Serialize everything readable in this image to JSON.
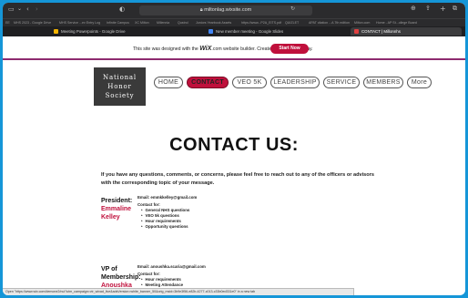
{
  "browser": {
    "url": "miltonlag.wixsite.com",
    "bookmarks": [
      "EE",
      "MHS 2023 - Google Drive",
      "MHS Service ...ev Entry Log",
      "Infinite Campus",
      "XC Milton",
      "Millennia",
      "Qustrol",
      "Juniors Yearbook Assets",
      "https://www...P2A_EITS.pdf",
      "QUIZLET",
      "APAT citation ...A 7th edition",
      "Milton.com",
      "Home - AP St...ollege Board"
    ],
    "tabs": [
      {
        "label": "Meeting Powerpoints - Google Drive",
        "icon_color": "#f4b400"
      },
      {
        "label": "New member meeting - Google Slides",
        "icon_color": "#4285f4"
      },
      {
        "label": "CONTACT | Millonnhs",
        "icon_color": "#e04040"
      }
    ]
  },
  "wix_banner": {
    "text_before": "This site was designed with the ",
    "brand": "WiX",
    "text_after": ".com website builder. Create your website today.",
    "cta": "Start Now"
  },
  "site": {
    "logo_lines": [
      "National",
      "Honor",
      "Society"
    ],
    "nav": [
      "HOME",
      "CONTACT",
      "VEO 5K",
      "LEADERSHIP",
      "SERVICE",
      "MEMBERS",
      "More"
    ],
    "heading": "CONTACT US:",
    "intro": "If you have any questions, comments, or concerns, please feel free to reach out to any of the officers or advisors with the corresponding topic of your message.",
    "contacts": [
      {
        "role": "President:",
        "name": "Emmaline Kelley",
        "email": "Email: emmkkelley@gmail.com",
        "contact_for": "Contact for:",
        "topics": [
          "General NHS questions",
          "VEO 5k questions",
          "Hour requirements",
          "Opportunity questions"
        ]
      },
      {
        "role": "VP of Membership:",
        "name": "Anoushka",
        "email": "Email: anoushka.scaria@gmail.com",
        "contact_for": "Contact for:",
        "topics": [
          "Hour requirements",
          "Meeting Attendance"
        ]
      }
    ]
  },
  "status_bar": "Open \"https://www.wix.com/demone2/nui?utm_campaign=vir_wixad_live&adsVersion=white_banner_50&orig_msid=3b9e3f56-e82b-4277-c013-c33b0ed331e0\" in a new tab"
}
